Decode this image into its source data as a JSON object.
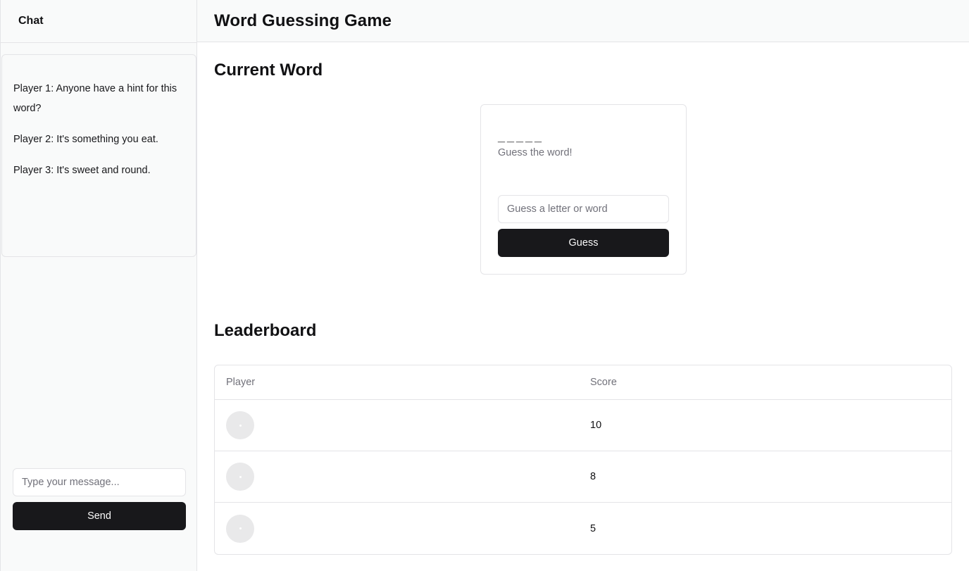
{
  "sidebar": {
    "title": "Chat",
    "messages": [
      "Player 1: Anyone have a hint for this word?",
      "Player 2: It's something you eat.",
      "Player 3: It's sweet and round."
    ],
    "input_placeholder": "Type your message...",
    "send_label": "Send"
  },
  "header": {
    "title": "Word Guessing Game"
  },
  "current_word": {
    "heading": "Current Word",
    "display": "_____",
    "hint": "Guess the word!",
    "input_placeholder": "Guess a letter or word",
    "guess_label": "Guess"
  },
  "leaderboard": {
    "heading": "Leaderboard",
    "columns": [
      "Player",
      "Score"
    ],
    "rows": [
      {
        "avatar": "avatar-placeholder",
        "score": "10"
      },
      {
        "avatar": "avatar-placeholder",
        "score": "8"
      },
      {
        "avatar": "avatar-placeholder",
        "score": "5"
      }
    ]
  }
}
